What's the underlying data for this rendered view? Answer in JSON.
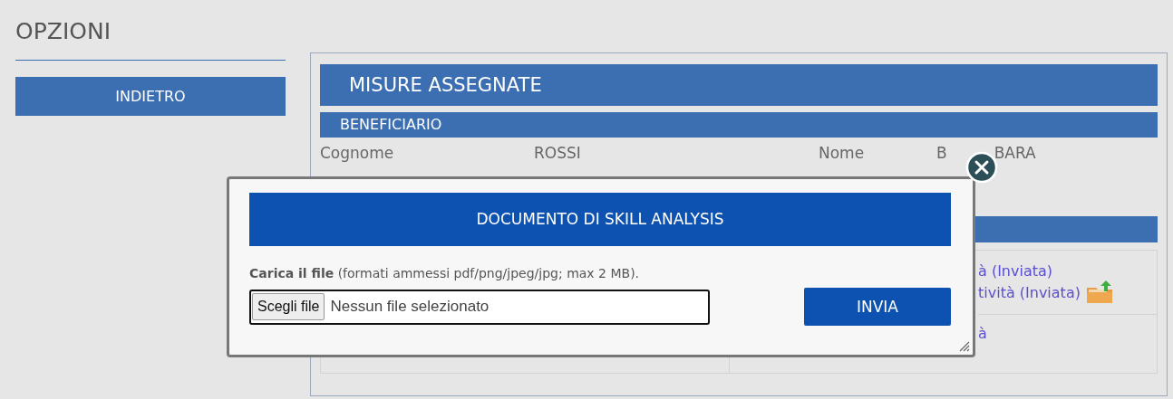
{
  "sidebar": {
    "title": "OPZIONI",
    "back_button": "INDIETRO"
  },
  "panel": {
    "title": "MISURE ASSEGNATE",
    "section": "BENEFICIARIO",
    "fields": [
      {
        "label": "Cognome",
        "value": "ROSSI"
      },
      {
        "label": "Nome",
        "value_parts": [
          "B",
          "BARA"
        ]
      }
    ],
    "links": [
      [
        "à (Inviata)",
        "tività (Inviata)"
      ],
      [
        "à"
      ]
    ]
  },
  "modal": {
    "title": "DOCUMENTO DI SKILL ANALYSIS",
    "instruction": "**Carica il file** (formati ammessi pdf/png/jpeg/jpg; max 2 MB).",
    "file_button": "Scegli file",
    "file_status": "Nessun file selezionato",
    "submit": "INVIA"
  }
}
